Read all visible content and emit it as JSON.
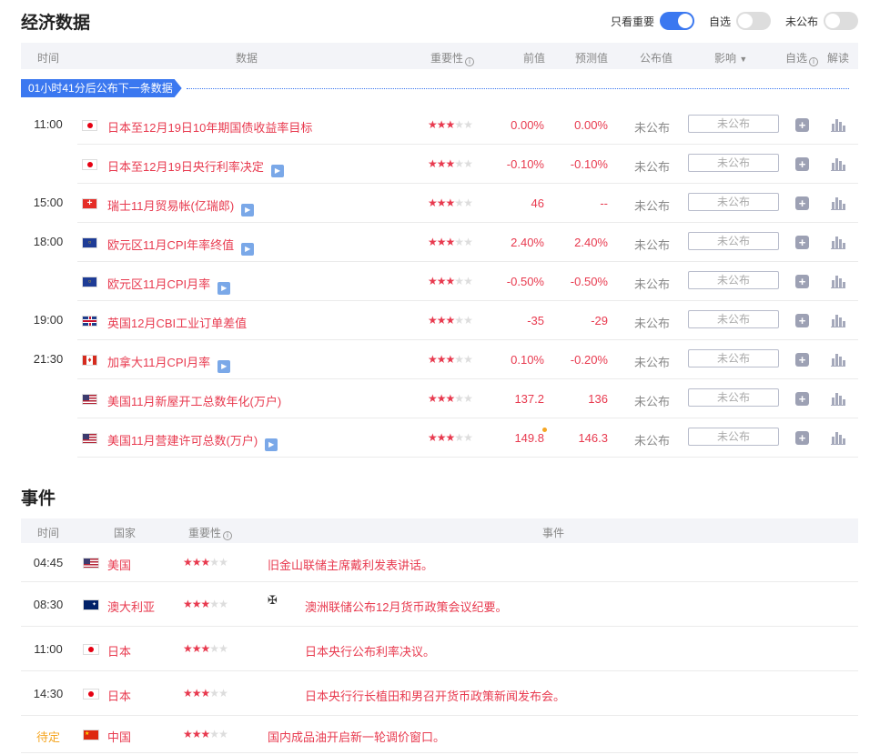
{
  "header": {
    "title": "经济数据",
    "toggles": [
      {
        "label": "只看重要",
        "on": true
      },
      {
        "label": "自选",
        "on": false
      },
      {
        "label": "未公布",
        "on": false
      }
    ]
  },
  "columns": {
    "time": "时间",
    "data": "数据",
    "importance": "重要性",
    "prev": "前值",
    "forecast": "预测值",
    "published": "公布值",
    "impact": "影响",
    "watch": "自选",
    "analysis": "解读"
  },
  "banner": "01小时41分后公布下一条数据",
  "rows": [
    {
      "time": "11:00",
      "flag": "jp",
      "name": "日本至12月19日10年期国债收益率目标",
      "video": false,
      "stars": 3,
      "prev": "0.00%",
      "forecast": "0.00%",
      "published": "未公布",
      "impact": "未公布"
    },
    {
      "time": "",
      "flag": "jp",
      "name": "日本至12月19日央行利率决定",
      "video": true,
      "stars": 3,
      "prev": "-0.10%",
      "forecast": "-0.10%",
      "published": "未公布",
      "impact": "未公布"
    },
    {
      "time": "15:00",
      "flag": "ch",
      "name": "瑞士11月贸易帐(亿瑞郎)",
      "video": true,
      "stars": 3,
      "prev": "46",
      "forecast": "--",
      "published": "未公布",
      "impact": "未公布"
    },
    {
      "time": "18:00",
      "flag": "eu",
      "name": "欧元区11月CPI年率终值",
      "video": true,
      "stars": 3,
      "prev": "2.40%",
      "forecast": "2.40%",
      "published": "未公布",
      "impact": "未公布"
    },
    {
      "time": "",
      "flag": "eu",
      "name": "欧元区11月CPI月率",
      "video": true,
      "stars": 3,
      "prev": "-0.50%",
      "forecast": "-0.50%",
      "published": "未公布",
      "impact": "未公布"
    },
    {
      "time": "19:00",
      "flag": "gb",
      "name": "英国12月CBI工业订单差值",
      "video": false,
      "stars": 3,
      "prev": "-35",
      "forecast": "-29",
      "published": "未公布",
      "impact": "未公布"
    },
    {
      "time": "21:30",
      "flag": "ca",
      "name": "加拿大11月CPI月率",
      "video": true,
      "stars": 3,
      "prev": "0.10%",
      "forecast": "-0.20%",
      "published": "未公布",
      "impact": "未公布"
    },
    {
      "time": "",
      "flag": "us",
      "name": "美国11月新屋开工总数年化(万户)",
      "video": false,
      "stars": 3,
      "prev": "137.2",
      "forecast": "136",
      "published": "未公布",
      "impact": "未公布"
    },
    {
      "time": "",
      "flag": "us",
      "name": "美国11月营建许可总数(万户)",
      "video": true,
      "stars": 3,
      "prev": "149.8",
      "forecast": "146.3",
      "published": "未公布",
      "impact": "未公布"
    }
  ],
  "events": {
    "title": "事件",
    "columns": {
      "time": "时间",
      "country": "国家",
      "importance": "重要性",
      "event": "事件"
    },
    "rows": [
      {
        "time": "04:45",
        "flag": "us",
        "country": "美国",
        "stars": 3,
        "logo": "",
        "text": "旧金山联储主席戴利发表讲话。"
      },
      {
        "time": "08:30",
        "flag": "au",
        "country": "澳大利亚",
        "stars": 3,
        "logo": "rba",
        "text": "澳洲联储公布12月货币政策会议纪要。"
      },
      {
        "time": "11:00",
        "flag": "jp",
        "country": "日本",
        "stars": 3,
        "logo": "boj",
        "text": "日本央行公布利率决议。"
      },
      {
        "time": "14:30",
        "flag": "jp",
        "country": "日本",
        "stars": 3,
        "logo": "boj",
        "text": "日本央行行长植田和男召开货币政策新闻发布会。"
      },
      {
        "time": "待定",
        "flag": "cn",
        "country": "中国",
        "stars": 3,
        "logo": "",
        "text": "国内成品油开启新一轮调价窗口。"
      }
    ]
  }
}
